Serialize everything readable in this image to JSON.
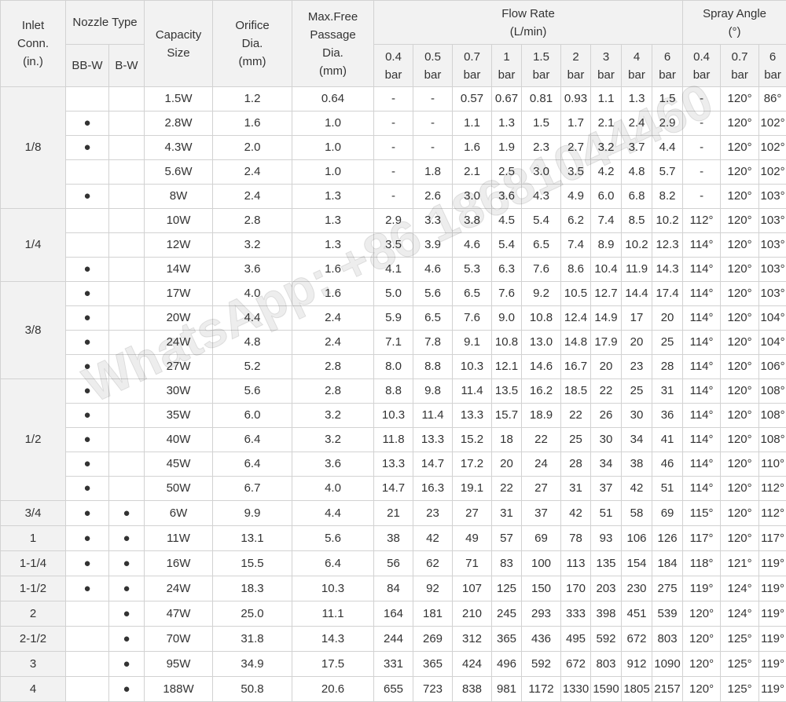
{
  "watermark": "WhatsApp: +86 18681044460",
  "headers": {
    "inlet": [
      "Inlet",
      "Conn.",
      "(in.)"
    ],
    "nozzle_type": "Nozzle Type",
    "bbw": "BB-W",
    "bw": "B-W",
    "capacity": [
      "Capacity",
      "Size"
    ],
    "orifice": [
      "Orifice",
      "Dia.",
      "(mm)"
    ],
    "passage": [
      "Max.Free",
      "Passage",
      "Dia.",
      "(mm)"
    ],
    "flow": [
      "Flow Rate",
      "(L/min)"
    ],
    "spray": [
      "Spray Angle",
      "(°)"
    ],
    "bar_unit": "bar",
    "flow_pressures": [
      "0.4",
      "0.5",
      "0.7",
      "1",
      "1.5",
      "2",
      "3",
      "4",
      "6"
    ],
    "spray_pressures": [
      "0.4",
      "0.7",
      "6"
    ]
  },
  "groups": [
    {
      "inlet": "1/8",
      "rows": [
        {
          "bbw": "",
          "bw": "",
          "cap": "1.5W",
          "orifice": "1.2",
          "passage": "0.64",
          "flow": [
            "-",
            "-",
            "0.57",
            "0.67",
            "0.81",
            "0.93",
            "1.1",
            "1.3",
            "1.5"
          ],
          "angle": [
            "-",
            "120°",
            "86°"
          ]
        },
        {
          "bbw": "●",
          "bw": "",
          "cap": "2.8W",
          "orifice": "1.6",
          "passage": "1.0",
          "flow": [
            "-",
            "-",
            "1.1",
            "1.3",
            "1.5",
            "1.7",
            "2.1",
            "2.4",
            "2.9"
          ],
          "angle": [
            "-",
            "120°",
            "102°"
          ]
        },
        {
          "bbw": "●",
          "bw": "",
          "cap": "4.3W",
          "orifice": "2.0",
          "passage": "1.0",
          "flow": [
            "-",
            "-",
            "1.6",
            "1.9",
            "2.3",
            "2.7",
            "3.2",
            "3.7",
            "4.4"
          ],
          "angle": [
            "-",
            "120°",
            "102°"
          ]
        },
        {
          "bbw": "",
          "bw": "",
          "cap": "5.6W",
          "orifice": "2.4",
          "passage": "1.0",
          "flow": [
            "-",
            "1.8",
            "2.1",
            "2.5",
            "3.0",
            "3.5",
            "4.2",
            "4.8",
            "5.7"
          ],
          "angle": [
            "-",
            "120°",
            "102°"
          ]
        },
        {
          "bbw": "●",
          "bw": "",
          "cap": "8W",
          "orifice": "2.4",
          "passage": "1.3",
          "flow": [
            "-",
            "2.6",
            "3.0",
            "3.6",
            "4.3",
            "4.9",
            "6.0",
            "6.8",
            "8.2"
          ],
          "angle": [
            "-",
            "120°",
            "103°"
          ]
        }
      ]
    },
    {
      "inlet": "1/4",
      "rows": [
        {
          "bbw": "",
          "bw": "",
          "cap": "10W",
          "orifice": "2.8",
          "passage": "1.3",
          "flow": [
            "2.9",
            "3.3",
            "3.8",
            "4.5",
            "5.4",
            "6.2",
            "7.4",
            "8.5",
            "10.2"
          ],
          "angle": [
            "112°",
            "120°",
            "103°"
          ]
        },
        {
          "bbw": "",
          "bw": "",
          "cap": "12W",
          "orifice": "3.2",
          "passage": "1.3",
          "flow": [
            "3.5",
            "3.9",
            "4.6",
            "5.4",
            "6.5",
            "7.4",
            "8.9",
            "10.2",
            "12.3"
          ],
          "angle": [
            "114°",
            "120°",
            "103°"
          ]
        },
        {
          "bbw": "●",
          "bw": "",
          "cap": "14W",
          "orifice": "3.6",
          "passage": "1.6",
          "flow": [
            "4.1",
            "4.6",
            "5.3",
            "6.3",
            "7.6",
            "8.6",
            "10.4",
            "11.9",
            "14.3"
          ],
          "angle": [
            "114°",
            "120°",
            "103°"
          ]
        }
      ]
    },
    {
      "inlet": "3/8",
      "rows": [
        {
          "bbw": "●",
          "bw": "",
          "cap": "17W",
          "orifice": "4.0",
          "passage": "1.6",
          "flow": [
            "5.0",
            "5.6",
            "6.5",
            "7.6",
            "9.2",
            "10.5",
            "12.7",
            "14.4",
            "17.4"
          ],
          "angle": [
            "114°",
            "120°",
            "103°"
          ]
        },
        {
          "bbw": "●",
          "bw": "",
          "cap": "20W",
          "orifice": "4.4",
          "passage": "2.4",
          "flow": [
            "5.9",
            "6.5",
            "7.6",
            "9.0",
            "10.8",
            "12.4",
            "14.9",
            "17",
            "20"
          ],
          "angle": [
            "114°",
            "120°",
            "104°"
          ]
        },
        {
          "bbw": "●",
          "bw": "",
          "cap": "24W",
          "orifice": "4.8",
          "passage": "2.4",
          "flow": [
            "7.1",
            "7.8",
            "9.1",
            "10.8",
            "13.0",
            "14.8",
            "17.9",
            "20",
            "25"
          ],
          "angle": [
            "114°",
            "120°",
            "104°"
          ]
        },
        {
          "bbw": "●",
          "bw": "",
          "cap": "27W",
          "orifice": "5.2",
          "passage": "2.8",
          "flow": [
            "8.0",
            "8.8",
            "10.3",
            "12.1",
            "14.6",
            "16.7",
            "20",
            "23",
            "28"
          ],
          "angle": [
            "114°",
            "120°",
            "106°"
          ]
        }
      ]
    },
    {
      "inlet": "1/2",
      "rows": [
        {
          "bbw": "●",
          "bw": "",
          "cap": "30W",
          "orifice": "5.6",
          "passage": "2.8",
          "flow": [
            "8.8",
            "9.8",
            "11.4",
            "13.5",
            "16.2",
            "18.5",
            "22",
            "25",
            "31"
          ],
          "angle": [
            "114°",
            "120°",
            "108°"
          ]
        },
        {
          "bbw": "●",
          "bw": "",
          "cap": "35W",
          "orifice": "6.0",
          "passage": "3.2",
          "flow": [
            "10.3",
            "11.4",
            "13.3",
            "15.7",
            "18.9",
            "22",
            "26",
            "30",
            "36"
          ],
          "angle": [
            "114°",
            "120°",
            "108°"
          ]
        },
        {
          "bbw": "●",
          "bw": "",
          "cap": "40W",
          "orifice": "6.4",
          "passage": "3.2",
          "flow": [
            "11.8",
            "13.3",
            "15.2",
            "18",
            "22",
            "25",
            "30",
            "34",
            "41"
          ],
          "angle": [
            "114°",
            "120°",
            "108°"
          ]
        },
        {
          "bbw": "●",
          "bw": "",
          "cap": "45W",
          "orifice": "6.4",
          "passage": "3.6",
          "flow": [
            "13.3",
            "14.7",
            "17.2",
            "20",
            "24",
            "28",
            "34",
            "38",
            "46"
          ],
          "angle": [
            "114°",
            "120°",
            "110°"
          ]
        },
        {
          "bbw": "●",
          "bw": "",
          "cap": "50W",
          "orifice": "6.7",
          "passage": "4.0",
          "flow": [
            "14.7",
            "16.3",
            "19.1",
            "22",
            "27",
            "31",
            "37",
            "42",
            "51"
          ],
          "angle": [
            "114°",
            "120°",
            "112°"
          ]
        }
      ]
    },
    {
      "inlet": "3/4",
      "rows": [
        {
          "bbw": "●",
          "bw": "●",
          "cap": "6W",
          "orifice": "9.9",
          "passage": "4.4",
          "flow": [
            "21",
            "23",
            "27",
            "31",
            "37",
            "42",
            "51",
            "58",
            "69"
          ],
          "angle": [
            "115°",
            "120°",
            "112°"
          ]
        }
      ]
    },
    {
      "inlet": "1",
      "rows": [
        {
          "bbw": "●",
          "bw": "●",
          "cap": "11W",
          "orifice": "13.1",
          "passage": "5.6",
          "flow": [
            "38",
            "42",
            "49",
            "57",
            "69",
            "78",
            "93",
            "106",
            "126"
          ],
          "angle": [
            "117°",
            "120°",
            "117°"
          ]
        }
      ]
    },
    {
      "inlet": "1-1/4",
      "rows": [
        {
          "bbw": "●",
          "bw": "●",
          "cap": "16W",
          "orifice": "15.5",
          "passage": "6.4",
          "flow": [
            "56",
            "62",
            "71",
            "83",
            "100",
            "113",
            "135",
            "154",
            "184"
          ],
          "angle": [
            "118°",
            "121°",
            "119°"
          ]
        }
      ]
    },
    {
      "inlet": "1-1/2",
      "rows": [
        {
          "bbw": "●",
          "bw": "●",
          "cap": "24W",
          "orifice": "18.3",
          "passage": "10.3",
          "flow": [
            "84",
            "92",
            "107",
            "125",
            "150",
            "170",
            "203",
            "230",
            "275"
          ],
          "angle": [
            "119°",
            "124°",
            "119°"
          ]
        }
      ]
    },
    {
      "inlet": "2",
      "rows": [
        {
          "bbw": "",
          "bw": "●",
          "cap": "47W",
          "orifice": "25.0",
          "passage": "11.1",
          "flow": [
            "164",
            "181",
            "210",
            "245",
            "293",
            "333",
            "398",
            "451",
            "539"
          ],
          "angle": [
            "120°",
            "124°",
            "119°"
          ]
        }
      ]
    },
    {
      "inlet": "2-1/2",
      "rows": [
        {
          "bbw": "",
          "bw": "●",
          "cap": "70W",
          "orifice": "31.8",
          "passage": "14.3",
          "flow": [
            "244",
            "269",
            "312",
            "365",
            "436",
            "495",
            "592",
            "672",
            "803"
          ],
          "angle": [
            "120°",
            "125°",
            "119°"
          ]
        }
      ]
    },
    {
      "inlet": "3",
      "rows": [
        {
          "bbw": "",
          "bw": "●",
          "cap": "95W",
          "orifice": "34.9",
          "passage": "17.5",
          "flow": [
            "331",
            "365",
            "424",
            "496",
            "592",
            "672",
            "803",
            "912",
            "1090"
          ],
          "angle": [
            "120°",
            "125°",
            "119°"
          ]
        }
      ]
    },
    {
      "inlet": "4",
      "rows": [
        {
          "bbw": "",
          "bw": "●",
          "cap": "188W",
          "orifice": "50.8",
          "passage": "20.6",
          "flow": [
            "655",
            "723",
            "838",
            "981",
            "1172",
            "1330",
            "1590",
            "1805",
            "2157"
          ],
          "angle": [
            "120°",
            "125°",
            "119°"
          ]
        }
      ]
    }
  ]
}
